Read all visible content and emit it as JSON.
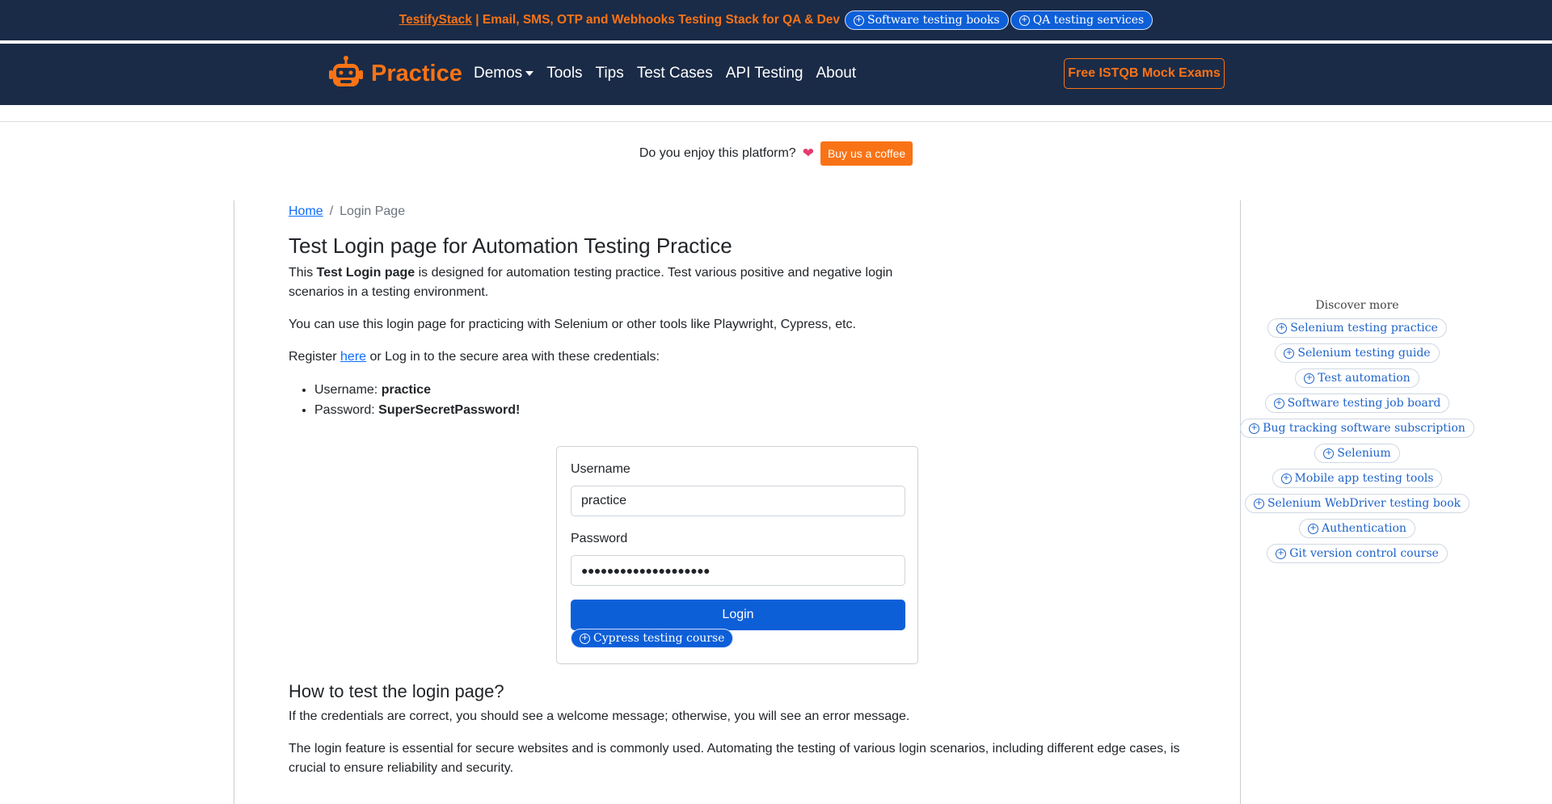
{
  "topbar": {
    "brand_link": "TestifyStack",
    "promo_text": " | Email, SMS, OTP and Webhooks Testing Stack for QA & Dev",
    "pills": [
      "Software testing books",
      "QA testing services"
    ]
  },
  "navbar": {
    "logo_text": "Practice",
    "items": [
      "Demos",
      "Tools",
      "Tips",
      "Test Cases",
      "API Testing",
      "About"
    ],
    "cta": "Free ISTQB Mock Exams"
  },
  "coffee": {
    "question": "Do you enjoy this platform?",
    "heart": "❤",
    "button": "Buy us a coffee"
  },
  "breadcrumb": {
    "home": "Home",
    "separator": "/",
    "current": "Login Page"
  },
  "content": {
    "title": "Test Login page for Automation Testing Practice",
    "p1_pre": "This ",
    "p1_bold": "Test Login page",
    "p1_post": " is designed for automation testing practice. Test various positive and negative login scenarios in a testing environment.",
    "p2": "You can use this login page for practicing with Selenium or other tools like Playwright, Cypress, etc.",
    "p3_pre": "Register ",
    "p3_link": "here",
    "p3_post": " or Log in to the secure area with these credentials:",
    "cred_username_label": "Username: ",
    "cred_username": "practice",
    "cred_password_label": "Password: ",
    "cred_password": "SuperSecretPassword!"
  },
  "login_form": {
    "username_label": "Username",
    "username_value": "practice",
    "password_label": "Password",
    "password_value": "●●●●●●●●●●●●●●●●●●●●",
    "login_button": "Login",
    "pill": "Cypress testing course"
  },
  "how_to": {
    "heading": "How to test the login page?",
    "p1": "If the credentials are correct, you should see a welcome message; otherwise, you will see an error message.",
    "p2": "The login feature is essential for secure websites and is commonly used. Automating the testing of various login scenarios, including different edge cases, is crucial to ensure reliability and security."
  },
  "sidebar": {
    "heading": "Discover more",
    "items": [
      "Selenium testing practice",
      "Selenium testing guide",
      "Test automation",
      "Software testing job board",
      "Bug tracking software subscription",
      "Selenium",
      "Mobile app testing tools",
      "Selenium WebDriver testing book",
      "Authentication",
      "Git version control course"
    ]
  },
  "colors": {
    "navy": "#1a2b47",
    "orange": "#f97316",
    "primary_blue": "#0d5fd8",
    "link_blue": "#0d6efd"
  }
}
